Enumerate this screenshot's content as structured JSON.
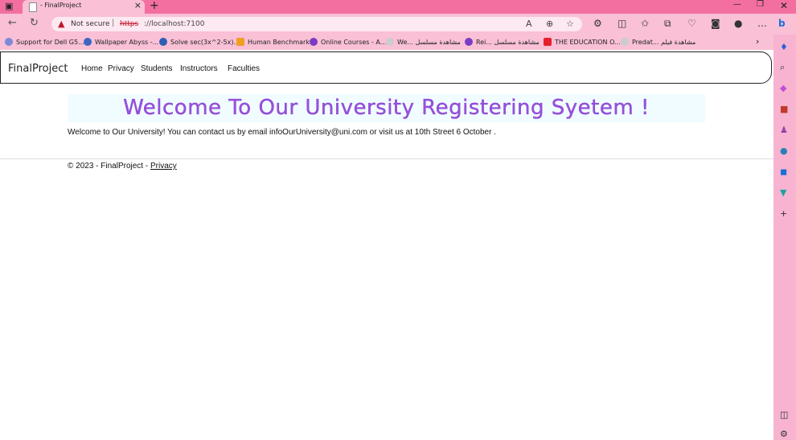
{
  "browser": {
    "tab_title": "- FinalProject",
    "not_secure": "Not secure",
    "url_scheme": "https",
    "url_rest": "://localhost:7100",
    "bookmarks": [
      "Support for Dell G5...",
      "Wallpaper Abyss -...",
      "Solve sec(3x^2-5x)...",
      "Human Benchmark",
      "Online Courses - A...",
      "We... مشاهدة مسلسل",
      "Rei... مشاهدة مسلسل",
      "THE EDUCATION O...",
      "Predat... مشاهدة فيلم"
    ]
  },
  "site": {
    "brand": "FinalProject",
    "nav": [
      "Home",
      "Privacy",
      "Students",
      "Instructors",
      "Faculties"
    ],
    "hero": "Welcome To Our University Registering Syetem !",
    "intro": "Welcome to Our University! You can contact us by email infoOurUniversity@uni.com or visit us at 10th Street 6 October .",
    "footer_prefix": "© 2023 - FinalProject - ",
    "footer_link": "Privacy"
  }
}
